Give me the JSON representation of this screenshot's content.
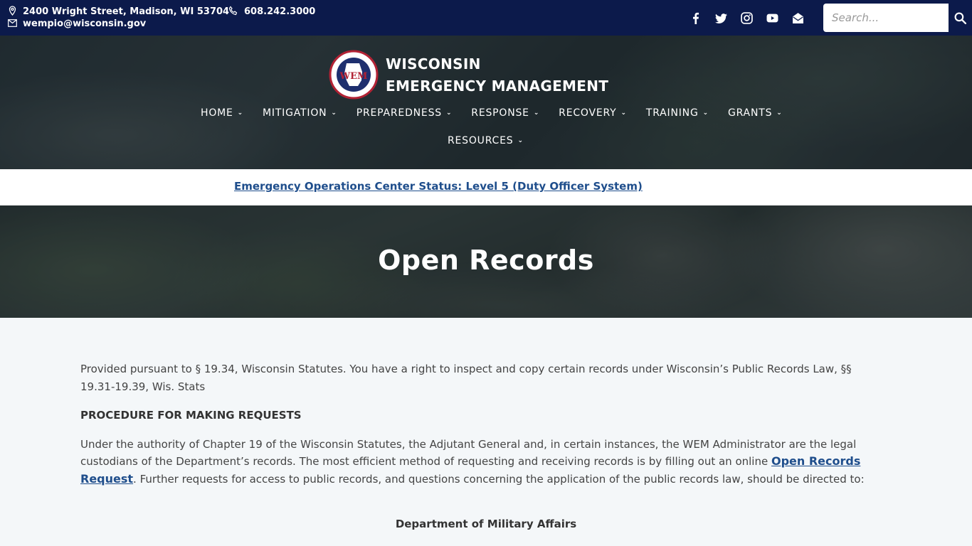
{
  "topbar": {
    "address": "2400 Wright Street, Madison, WI 53704",
    "phone": "608.242.3000",
    "email": "wempio@wisconsin.gov",
    "background_color": "#0c1a4b",
    "socials": [
      {
        "icon": "facebook-icon"
      },
      {
        "icon": "twitter-icon"
      },
      {
        "icon": "instagram-icon"
      },
      {
        "icon": "youtube-icon"
      },
      {
        "icon": "email-envelope-icon"
      }
    ],
    "search_placeholder": "Search..."
  },
  "header": {
    "logo_text": "WEM",
    "brand_line1": "WISCONSIN",
    "brand_line2": "EMERGENCY MANAGEMENT",
    "nav": [
      {
        "label": "HOME"
      },
      {
        "label": "MITIGATION"
      },
      {
        "label": "PREPAREDNESS"
      },
      {
        "label": "RESPONSE"
      },
      {
        "label": "RECOVERY"
      },
      {
        "label": "TRAINING"
      },
      {
        "label": "GRANTS"
      },
      {
        "label": "RESOURCES"
      }
    ]
  },
  "alert": {
    "text": "Emergency Operations Center Status: Level 5 (Duty Officer System)",
    "link_color": "#1f4e8c"
  },
  "hero": {
    "title": "Open Records"
  },
  "content": {
    "intro": "Provided pursuant to § 19.34, Wisconsin Statutes. You have a right to inspect and copy certain records under Wisconsin’s Public Records Law, §§ 19.31-19.39, Wis. Stats",
    "procedure_heading": "PROCEDURE FOR MAKING REQUESTS",
    "procedure_before": "Under the authority of Chapter 19 of the Wisconsin Statutes, the Adjutant General and, in certain instances, the WEM Administrator are the legal custodians of the Department’s records. The most efficient method of requesting and receiving records is by filling out an online ",
    "procedure_link": "Open Records Request",
    "procedure_after": ". Further requests for access to public records, and questions concerning the application of the public records law, should be directed to:",
    "department": "Department of Military Affairs"
  }
}
